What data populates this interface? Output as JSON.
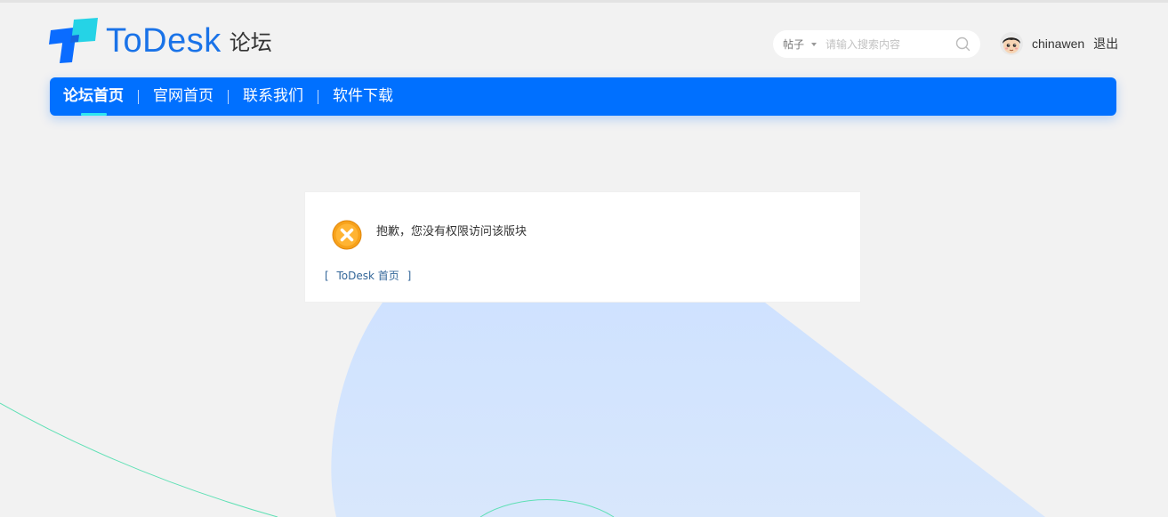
{
  "header": {
    "logo_text": "ToDesk",
    "logo_sub": "论坛",
    "search": {
      "type_label": "帖子",
      "placeholder": "请输入搜索内容"
    },
    "user": {
      "username": "chinawen",
      "logout_label": "退出"
    }
  },
  "nav": {
    "items": [
      {
        "label": "论坛首页",
        "active": true
      },
      {
        "label": "官网首页"
      },
      {
        "label": "联系我们"
      },
      {
        "label": "软件下载"
      }
    ]
  },
  "message": {
    "text": "抱歉，您没有权限访问该版块",
    "link_open": "[",
    "link_label": "ToDesk 首页",
    "link_close": "]"
  },
  "colors": {
    "nav_bg": "#0070ff",
    "nav_active_underline": "#2ee6f0",
    "logo_blue": "#1a73e8",
    "error_orange": "#f5a623",
    "link_blue": "#336699",
    "page_bg": "#f2f2f2"
  }
}
